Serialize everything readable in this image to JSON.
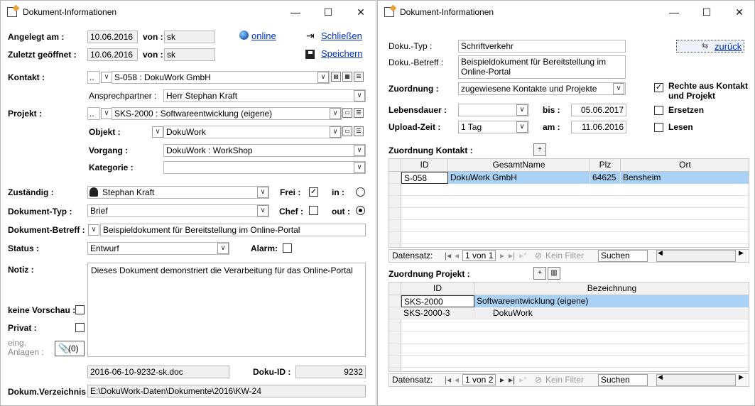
{
  "window1": {
    "title": "Dokument-Informationen",
    "controls": {
      "min": "—",
      "max": "☐",
      "close": "✕"
    },
    "angelegt_label": "Angelegt am :",
    "angelegt_date": "10.06.2016",
    "von_label": "von :",
    "angelegt_von": "sk",
    "online_link": "online",
    "schliessen_link": "Schließen",
    "geoeffnet_label": "Zuletzt geöffnet :",
    "geoeffnet_date": "10.06.2016",
    "geoeffnet_von": "sk",
    "speichern_link": "Speichern",
    "kontakt_label": "Kontakt :",
    "kontakt_prefix": "..",
    "kontakt_value": "S-058 : DokuWork GmbH",
    "ansprech_label": "Ansprechpartner :",
    "ansprech_value": "Herr Stephan Kraft",
    "projekt_label": "Projekt :",
    "projekt_prefix": "..",
    "projekt_value": "SKS-2000 : Softwareentwicklung (eigene)",
    "objekt_label": "Objekt :",
    "objekt_value": "DokuWork",
    "vorgang_label": "Vorgang :",
    "vorgang_value": "DokuWork : WorkShop",
    "kategorie_label": "Kategorie :",
    "kategorie_value": "",
    "zustaendig_label": "Zuständig :",
    "zustaendig_value": "Stephan Kraft",
    "frei_label": "Frei :",
    "frei_check": "✓",
    "in_label": "in :",
    "doktyp_label": "Dokument-Typ :",
    "doktyp_value": "Brief",
    "chef_label": "Chef :",
    "out_label": "out :",
    "betreff_label": "Dokument-Betreff :",
    "betreff_value": "Beispieldokument für Bereitstellung im Online-Portal",
    "status_label": "Status :",
    "status_value": "Entwurf",
    "alarm_label": "Alarm:",
    "notiz_label": "Notiz :",
    "notiz_value": "Dieses Dokument demonstriert die Verarbeitung für das Online-Portal",
    "vorschau_label": "keine Vorschau :",
    "privat_label": "Privat :",
    "anlagen_label1": "eing.",
    "anlagen_label2": "Anlagen :",
    "anlagen_value": "(0)",
    "dateiname": "2016-06-10-9232-sk.doc",
    "dokuid_label": "Doku-ID :",
    "dokuid_value": "9232",
    "verzeichnis_label": "Dokum.Verzeichnis :",
    "verzeichnis_value": "E:\\DokuWork-Daten\\Dokumente\\2016\\KW-24"
  },
  "window2": {
    "title": "Dokument-Informationen",
    "controls": {
      "min": "—",
      "max": "☐",
      "close": "✕"
    },
    "typ_label": "Doku.-Typ :",
    "typ_value": "Schriftverkehr",
    "zurueck_link": "zurück",
    "betreff_label": "Doku.-Betreff :",
    "betreff_line1": "Beispieldokument für Bereitstellung im",
    "betreff_line2": "Online-Portal",
    "zuordnung_label": "Zuordnung :",
    "zuordnung_value": "zugewiesene Kontakte und Projekte",
    "rechte_label1": "Rechte aus Kontakt",
    "rechte_label2": "und Projekt",
    "rechte_check": "✓",
    "lebensdauer_label": "Lebensdauer :",
    "lebensdauer_value": "",
    "bis_label": "bis :",
    "bis_value": "05.06.2017",
    "ersetzen_label": "Ersetzen",
    "upload_label": "Upload-Zeit :",
    "upload_value": "1 Tag",
    "am_label": "am :",
    "am_value": "11.06.2016",
    "lesen_label": "Lesen",
    "kontakt_section": "Zuordnung Kontakt :",
    "kontakt_cols": [
      "ID",
      "GesamtName",
      "Plz",
      "Ort"
    ],
    "kontakt_rows": [
      [
        "S-058",
        "DokuWork GmbH",
        "64625",
        "Bensheim"
      ]
    ],
    "nav1": {
      "label": "Datensatz:",
      "pos": "1 von 1",
      "filter": "Kein Filter",
      "search": "Suchen"
    },
    "projekt_section": "Zuordnung Projekt :",
    "projekt_cols": [
      "ID",
      "Bezeichnung"
    ],
    "projekt_rows": [
      [
        "SKS-2000",
        "Softwareentwicklung (eigene)"
      ],
      [
        "SKS-2000-3",
        "DokuWork"
      ]
    ],
    "nav2": {
      "label": "Datensatz:",
      "pos": "1 von 2",
      "filter": "Kein Filter",
      "search": "Suchen"
    }
  },
  "colors": {
    "link": "#0033cc",
    "selected_row": "#a9d1f5",
    "header_bg": "#f2f2f2"
  }
}
